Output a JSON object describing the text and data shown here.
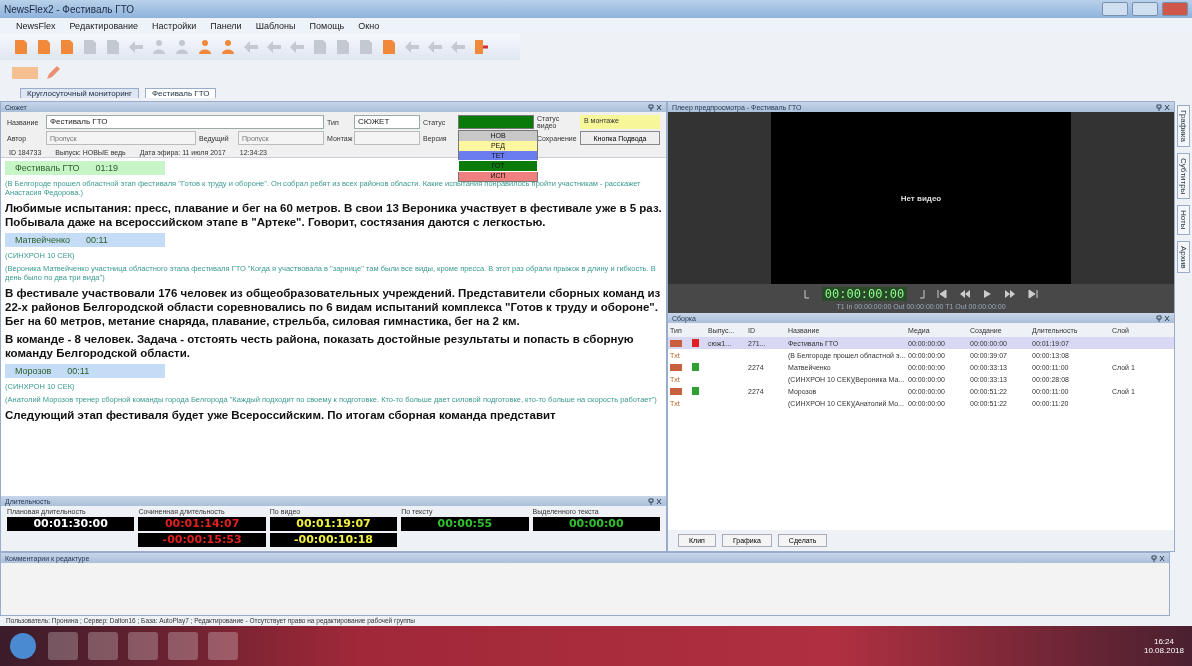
{
  "window": {
    "title": "NewsFlex2 - Фестиваль ГТО"
  },
  "menu": [
    "NewsFlex",
    "Редактирование",
    "Настройки",
    "Панели",
    "Шаблоны",
    "Помощь",
    "Окно"
  ],
  "toolbar": [
    {
      "kind": "page",
      "disabled": false
    },
    {
      "kind": "page",
      "disabled": false
    },
    {
      "kind": "page",
      "disabled": false
    },
    {
      "kind": "page",
      "disabled": true
    },
    {
      "kind": "page",
      "disabled": true
    },
    {
      "kind": "arrow",
      "disabled": true
    },
    {
      "kind": "person",
      "disabled": true
    },
    {
      "kind": "person",
      "disabled": true
    },
    {
      "kind": "person",
      "disabled": false
    },
    {
      "kind": "person",
      "disabled": false
    },
    {
      "kind": "arrow",
      "disabled": true
    },
    {
      "kind": "arrow",
      "disabled": true
    },
    {
      "kind": "arrow",
      "disabled": true
    },
    {
      "kind": "page",
      "disabled": true
    },
    {
      "kind": "page",
      "disabled": true
    },
    {
      "kind": "page",
      "disabled": true
    },
    {
      "kind": "page",
      "disabled": false
    },
    {
      "kind": "arrow",
      "disabled": true
    },
    {
      "kind": "arrow",
      "disabled": true
    },
    {
      "kind": "arrow",
      "disabled": true
    },
    {
      "kind": "exit",
      "disabled": false
    }
  ],
  "doc_tabs": [
    {
      "label": "Круглосуточный мониторинг",
      "selected": false
    },
    {
      "label": "Фестиваль ГТО",
      "selected": true
    }
  ],
  "story": {
    "title": "Сюжет",
    "name_label": "Название",
    "name_value": "Фестиваль ГТО",
    "type_label": "Тип",
    "type_value": "СЮЖЕТ",
    "status_label": "Статус",
    "status_options": [
      {
        "label": "НОВ",
        "color": "#c8c8c8",
        "selected": false
      },
      {
        "label": "РЕД",
        "color": "#fff7a0",
        "selected": false
      },
      {
        "label": "ТЕТ",
        "color": "#6a7cf0",
        "selected": false
      },
      {
        "label": "ГОТ",
        "color": "#0a7a0a",
        "selected": true
      },
      {
        "label": "ИСП",
        "color": "#f08080",
        "selected": false
      }
    ],
    "video_status_label": "Статус видео",
    "video_status_value": "В монтаже",
    "author_label": "Автор",
    "author_placeholder": "Пропуск",
    "lead_label": "Ведущий",
    "lead_placeholder": "Пропуск",
    "edit_label": "Монтаж",
    "version_label": "Версия",
    "save_label": "Сохранение",
    "save_button": "Кнопка Подвода",
    "info": [
      "ID 184733",
      "Выпуск: НОВЫЕ ведь",
      "Дата эфира: 11 июля 2017",
      "12:34:23"
    ],
    "blocks": [
      {
        "kind": "segment",
        "title": "Фестиваль ГТО",
        "time": "01:19",
        "color": "#c8f5c8"
      },
      {
        "kind": "note",
        "text": "(В Белгороде прошел областной этап фестиваля \"Готов к труду и обороне\". Он собрал ребят из всех районов области. Какие испытания понравилось пройти участникам - расскажет Анастасия Федорова.)"
      },
      {
        "kind": "body",
        "text": "Любимые испытания: пресс, плавание и бег на 60 метров. В свои 13 Вероника участвует в фестивале уже в 5 раз.  Побывала даже на всероссийском этапе в \"Артеке\". Говорит, состязания даются с легкостью."
      },
      {
        "kind": "segment",
        "title": "Матвейченко",
        "time": "00:11",
        "color": "#c4dcf5"
      },
      {
        "kind": "note",
        "text": "(СИНХРОН 10 СЕК)"
      },
      {
        "kind": "note",
        "text": "(Вероника Матвейченко участница областного этапа фестиваля ГТО \"Когда я участвовала в \"зарнице\" там были все виды, кроме пресса. В этот раз обрали прыжок в длину и гибкость. В день было по два три вида\")"
      },
      {
        "kind": "body",
        "text": "В фестивале участвовали 176 человек из общеобразовательных учреждений. Представители сборных команд из 22-х районов Белгородской области соревновались по 6 видам испытаний комплекса \"Готов к труду и обороне\". Бег на 60 метров, метание снаряда, плавание, стрельба, силовая гимнастика, бег на 2 км."
      },
      {
        "kind": "body",
        "text": "В команде - 8 человек. Задача - отстоять честь района, показать достойные результаты и попасть в сборную команду Белгородской области."
      },
      {
        "kind": "segment",
        "title": "Морозов",
        "time": "00:11",
        "color": "#c4dcf5"
      },
      {
        "kind": "note",
        "text": "(СИНХРОН 10 СЕК)"
      },
      {
        "kind": "note",
        "text": "(Анатолий Морозов тренер сборной команды города Белгорода \"Каждый подходит по своему к подготовке. Кто-то больше дает силовой подготовке, кто-то больше на скорость работает\")"
      },
      {
        "kind": "body",
        "text": "Следующий этап фестиваля будет уже Всероссийским. По итогам сборная команда представит"
      }
    ]
  },
  "durations": {
    "title": "Длительность",
    "columns": [
      {
        "label": "Плановая длительность",
        "kind": "plan",
        "values": [
          "00:01:30:00"
        ]
      },
      {
        "label": "Сочиненная длительность",
        "kind": "composed",
        "values": [
          "00:01:14:07",
          "-00:00:15:53"
        ]
      },
      {
        "label": "По видео",
        "kind": "video",
        "values": [
          "00:01:19:07",
          "-00:00:10:18"
        ]
      },
      {
        "label": "По тексту",
        "kind": "text",
        "values": [
          "00:00:55"
        ]
      },
      {
        "label": "Выделенного текста",
        "kind": "text",
        "values": [
          "00:00:00"
        ]
      }
    ]
  },
  "player": {
    "title": "Плеер предпросмотра - Фестиваль ГТО",
    "message": "Нет видео",
    "timecode": "00:00:00:00",
    "marks": "T1  In 00:00:00:00  Out 00:00:00:00  T1  Out 00:00:00:00"
  },
  "assembly": {
    "title": "Сборка",
    "columns": [
      "Тип",
      "",
      "Выпус...",
      "ID",
      "Название",
      "Медиа",
      "Создание",
      "Длительность",
      "Слой"
    ],
    "rows": [
      {
        "kind": "clip",
        "selected": true,
        "color": "#e02020",
        "issue": "сюж1...",
        "id": "271...",
        "name": "Фестиваль ГТО",
        "media": "00:00:00:00",
        "created": "00:00:00:00",
        "duration": "00:01:19:07"
      },
      {
        "kind": "text",
        "selected": false,
        "type": "Txt",
        "name": "(В Белгороде прошел областной э...",
        "media": "00:00:00:00",
        "created": "00:00:39:07",
        "duration": "00:00:13:08"
      },
      {
        "kind": "clip",
        "selected": false,
        "color": "#30a030",
        "id": "2274",
        "name": "Матвейченко",
        "media": "00:00:00:00",
        "created": "00:00:33:13",
        "duration": "00:00:11:00",
        "layer": "Слой 1"
      },
      {
        "kind": "text",
        "selected": false,
        "type": "Txt",
        "name": "(СИНХРОН 10 СЕК)(Вероника Ма...",
        "media": "00:00:00:00",
        "created": "00:00:33:13",
        "duration": "00:00:28:08"
      },
      {
        "kind": "clip",
        "selected": false,
        "color": "#30a030",
        "id": "2274",
        "name": "Морозов",
        "media": "00:00:00:00",
        "created": "00:00:51:22",
        "duration": "00:00:11:00",
        "layer": "Слой 1"
      },
      {
        "kind": "text",
        "selected": false,
        "type": "Txt",
        "name": "(СИНХРОН 10 СЕК)(Анатолий Мо...",
        "media": "00:00:00:00",
        "created": "00:00:51:22",
        "duration": "00:00:11:20"
      }
    ],
    "buttons": [
      "Клип",
      "Графика",
      "Сделать"
    ]
  },
  "side_tabs": [
    "Графика",
    "Субтитры",
    "Ноты",
    "Архив"
  ],
  "comments": {
    "title": "Комментарии к редактуре"
  },
  "status_bar": "Пользователь: Пронина ; Сервер: Dalton16 ; База: AutoPlay7 ; Редактирование - Отсутствует право на редактирование рабочей группы",
  "taskbar": {
    "clock": "16:24",
    "date": "10.08.2018"
  }
}
